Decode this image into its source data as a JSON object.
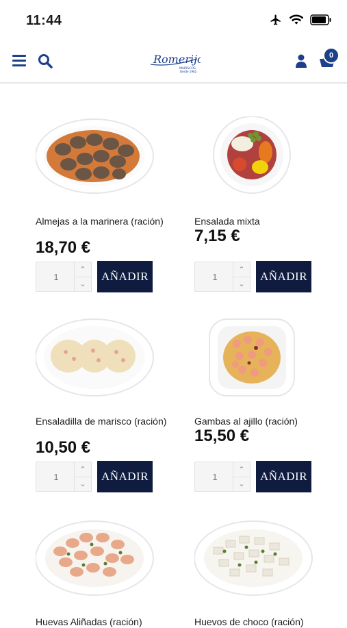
{
  "status": {
    "time": "11:44"
  },
  "header": {
    "logo_text": "Romerijo",
    "logo_sub": "MARISCOS",
    "logo_since": "Desde 1962",
    "cart_count": "0"
  },
  "products": [
    {
      "name": "Almejas a la marinera (ración)",
      "price": "18,70 €",
      "qty": "1",
      "add_label": "AÑADIR"
    },
    {
      "name": "Ensalada mixta",
      "price": "7,15 €",
      "qty": "1",
      "add_label": "AÑADIR"
    },
    {
      "name": "Ensaladilla de marisco (ración)",
      "price": "10,50 €",
      "qty": "1",
      "add_label": "AÑADIR"
    },
    {
      "name": "Gambas al ajillo (ración)",
      "price": "15,50 €",
      "qty": "1",
      "add_label": "AÑADIR"
    },
    {
      "name": "Huevas Aliñadas (ración)",
      "price": "",
      "qty": "",
      "add_label": ""
    },
    {
      "name": "Huevos de choco (ración)",
      "price": "",
      "qty": "",
      "add_label": ""
    }
  ],
  "icons": {
    "menu": "hamburger-icon",
    "search": "search-icon",
    "user": "user-icon",
    "cart": "cart-icon"
  },
  "colors": {
    "brand": "#1d3f8c",
    "button": "#0f1c3f"
  }
}
